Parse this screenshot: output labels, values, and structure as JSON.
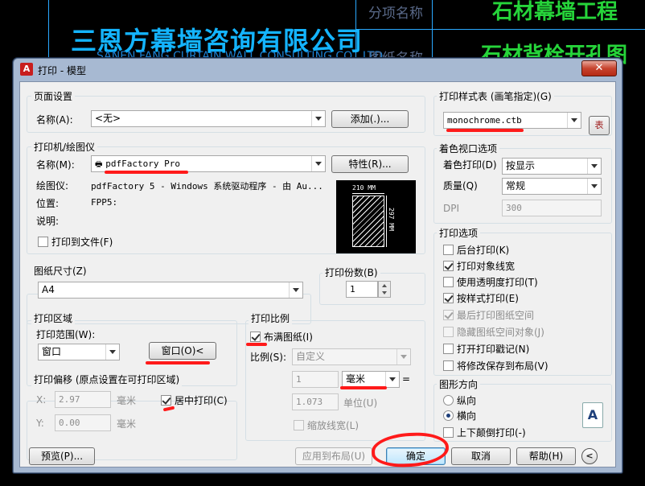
{
  "cad": {
    "company": "三恩方幕墙咨询有限公司",
    "company_sub": "SANEN FANG CURTAIN WALL CONSULTING CO., LTD",
    "field_1": "分项名称",
    "field_2": "图纸名称",
    "value_1": "石材幕墙工程",
    "value_2": "石材背栓开孔图"
  },
  "dialog": {
    "title": "打印 - 模型",
    "close": "✕"
  },
  "page_setup": {
    "group": "页面设置",
    "name_label": "名称(A):",
    "name_value": "<无>",
    "add_button": "添加(.)..."
  },
  "printer": {
    "group": "打印机/绘图仪",
    "name_label": "名称(M):",
    "name_value": "pdfFactory Pro",
    "properties_button": "特性(R)...",
    "plotter_label": "绘图仪:",
    "plotter_value": "pdfFactory 5 - Windows 系统驱动程序 - 由 Au...",
    "location_label": "位置:",
    "location_value": "FPP5:",
    "desc_label": "说明:",
    "print_to_file": "打印到文件(F)",
    "paper_width": "210 MM",
    "paper_height": "297 MM"
  },
  "paper_size": {
    "group": "图纸尺寸(Z)",
    "value": "A4"
  },
  "copies": {
    "group": "打印份数(B)",
    "value": "1"
  },
  "plot_area": {
    "group": "打印区域",
    "range_label": "打印范围(W):",
    "range_value": "窗口",
    "window_button": "窗口(O)<"
  },
  "plot_offset": {
    "group": "打印偏移 (原点设置在可打印区域)",
    "x_label": "X:",
    "x_value": "2.97",
    "x_unit": "毫米",
    "y_label": "Y:",
    "y_value": "0.00",
    "y_unit": "毫米",
    "center": "居中打印(C)"
  },
  "plot_scale": {
    "group": "打印比例",
    "fit": "布满图纸(I)",
    "scale_label": "比例(S):",
    "scale_value": "自定义",
    "val1": "1",
    "unit": "毫米",
    "eq": "=",
    "val2": "1.073",
    "unit2": "单位(U)",
    "lineweights": "缩放线宽(L)"
  },
  "style_table": {
    "group": "打印样式表 (画笔指定)(G)",
    "value": "monochrome.ctb",
    "edit_icon": "表"
  },
  "viewport": {
    "group": "着色视口选项",
    "shade_label": "着色打印(D)",
    "shade_value": "按显示",
    "quality_label": "质量(Q)",
    "quality_value": "常规",
    "dpi_label": "DPI",
    "dpi_value": "300"
  },
  "options": {
    "group": "打印选项",
    "items": [
      {
        "label": "后台打印(K)",
        "checked": false,
        "disabled": false
      },
      {
        "label": "打印对象线宽",
        "checked": true,
        "disabled": false
      },
      {
        "label": "使用透明度打印(T)",
        "checked": false,
        "disabled": false
      },
      {
        "label": "按样式打印(E)",
        "checked": true,
        "disabled": false
      },
      {
        "label": "最后打印图纸空间",
        "checked": true,
        "disabled": true
      },
      {
        "label": "隐藏图纸空间对象(J)",
        "checked": false,
        "disabled": true
      },
      {
        "label": "打开打印戳记(N)",
        "checked": false,
        "disabled": false
      },
      {
        "label": "将修改保存到布局(V)",
        "checked": false,
        "disabled": false
      }
    ]
  },
  "orientation": {
    "group": "图形方向",
    "portrait": "纵向",
    "landscape": "横向",
    "upside_down": "上下颠倒打印(-)",
    "icon": "A"
  },
  "footer": {
    "preview": "预览(P)...",
    "apply": "应用到布局(U)",
    "ok": "确定",
    "cancel": "取消",
    "help": "帮助(H)",
    "more": "<"
  }
}
